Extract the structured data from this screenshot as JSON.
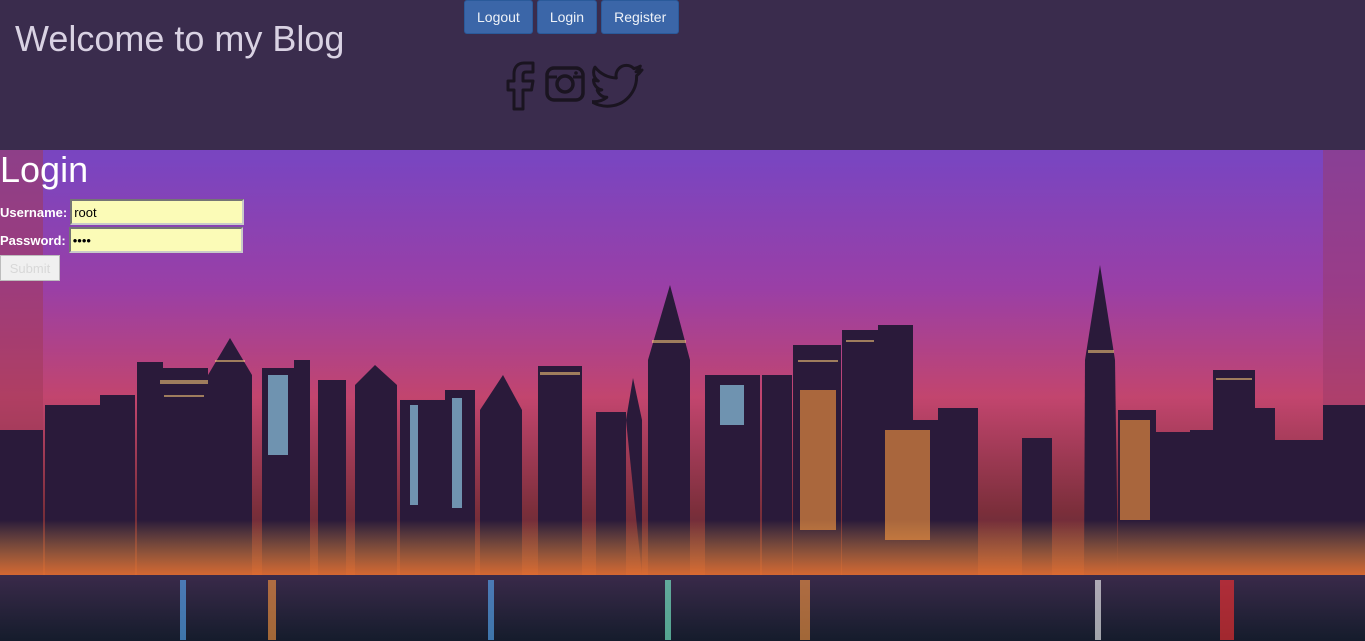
{
  "header": {
    "title": "Welcome to my Blog",
    "nav": [
      {
        "label": "Logout"
      },
      {
        "label": "Login"
      },
      {
        "label": "Register"
      }
    ],
    "social_icons": [
      "facebook-icon",
      "instagram-icon",
      "twitter-icon"
    ]
  },
  "login": {
    "title": "Login",
    "username_label": "Username:",
    "username_value": "root",
    "password_label": "Password:",
    "password_value": "root",
    "submit_label": "Submit"
  },
  "colors": {
    "header_bg": "#362a44",
    "nav_button": "#3b66a8",
    "input_bg": "#fbfbb7"
  }
}
